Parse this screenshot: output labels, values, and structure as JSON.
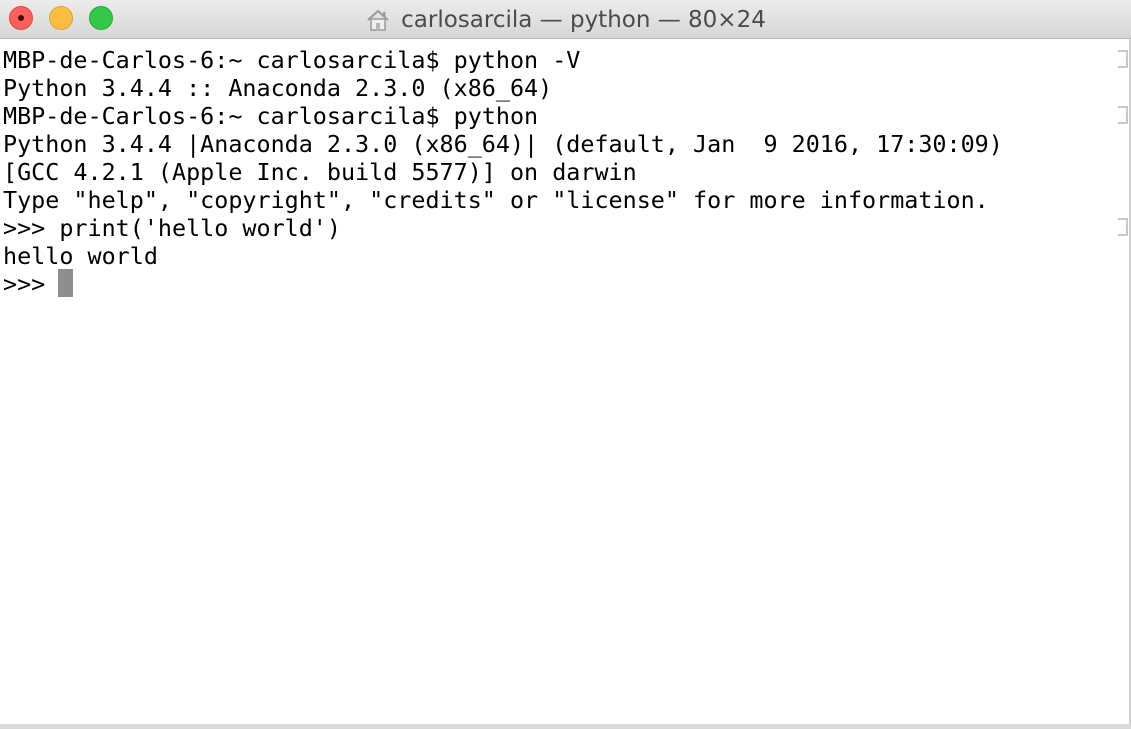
{
  "window": {
    "title": "carlosarcila — python — 80×24"
  },
  "icons": {
    "title_icon": "home-folder-icon"
  },
  "terminal": {
    "lines": [
      "MBP-de-Carlos-6:~ carlosarcila$ python -V",
      "Python 3.4.4 :: Anaconda 2.3.0 (x86_64)",
      "MBP-de-Carlos-6:~ carlosarcila$ python",
      "Python 3.4.4 |Anaconda 2.3.0 (x86_64)| (default, Jan  9 2016, 17:30:09)",
      "[GCC 4.2.1 (Apple Inc. build 5577)] on darwin",
      "Type \"help\", \"copyright\", \"credits\" or \"license\" for more information.",
      ">>> print('hello world')",
      "hello world",
      ">>> "
    ]
  },
  "colors": {
    "close": "#fc605c",
    "minimize": "#fdbc40",
    "zoom": "#34c84a",
    "text": "#000000",
    "cursor": "#8e8e8e"
  }
}
